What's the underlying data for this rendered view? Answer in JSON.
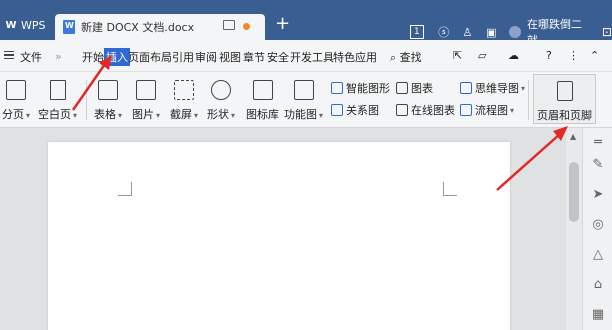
{
  "titlebar": {
    "wps_tab": "WPS",
    "doc_tab_title": "新建 DOCX 文档.docx",
    "plus": "+",
    "badge": "1",
    "user_text": "在哪跌倒二就",
    "window_controls": "⊡"
  },
  "menubar": {
    "file": "文件",
    "more": "»",
    "tabs": [
      "开始",
      "插入",
      "页面布局",
      "引用",
      "审阅",
      "视图",
      "章节",
      "安全",
      "开发工具",
      "特色应用"
    ],
    "search": "查找",
    "help": "?",
    "more_menu": "⋮",
    "collapse": "⌃"
  },
  "ribbon": {
    "page_break": "分页",
    "blank_page": "空白页",
    "table": "表格",
    "picture": "图片",
    "screenshot": "截屏",
    "shape": "形状",
    "icon_library": "图标库",
    "function_chart": "功能图",
    "smart_shape": "智能图形",
    "chart": "图表",
    "relation_chart": "关系图",
    "online_chart": "在线图表",
    "mind_map": "思维导图",
    "flowchart": "流程图",
    "header_footer": "页眉和页脚"
  },
  "colors": {
    "titlebar": "#3a5d92",
    "accent": "#2e6ad1",
    "annotation_arrow": "#e02a2a"
  }
}
